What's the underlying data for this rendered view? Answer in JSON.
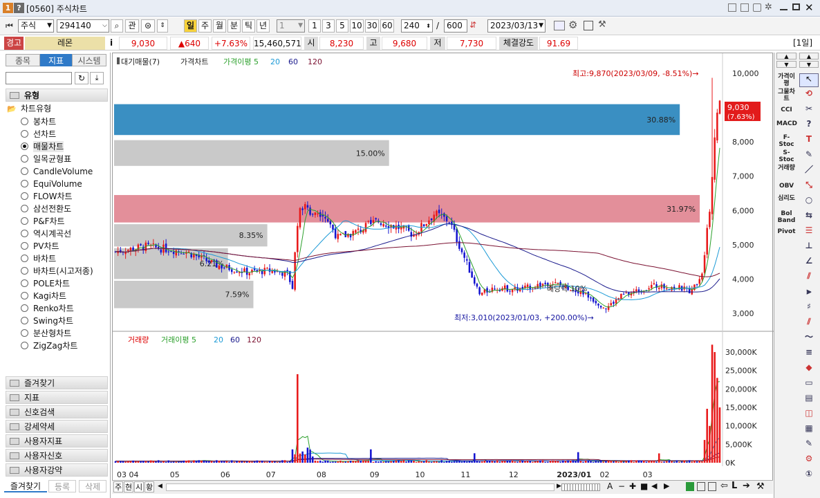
{
  "window": {
    "badge": "1",
    "help": "?",
    "title": "[0560] 주식차트"
  },
  "toolbar": {
    "market": "주식",
    "code": "294140",
    "btn_kwan": "관",
    "periods": [
      "일",
      "주",
      "월",
      "분",
      "틱",
      "년"
    ],
    "interval_value": "1",
    "quick": [
      "1",
      "3",
      "5",
      "10",
      "30",
      "60"
    ],
    "count": "240",
    "slash": "/",
    "total": "600",
    "date": "2023/03/13"
  },
  "quote": {
    "warn": "경고",
    "name": "레몬",
    "info": "i",
    "price": "9,030",
    "change": "▲640",
    "pct": "+7.63%",
    "volume": "15,460,571",
    "open_label": "시",
    "open": "8,230",
    "high_label": "고",
    "high": "9,680",
    "low_label": "저",
    "low": "7,730",
    "strength_label": "체결강도",
    "strength": "91.69",
    "day": "[1일]"
  },
  "left": {
    "tabs": [
      "종목",
      "지표",
      "시스템"
    ],
    "group": "유형",
    "subgroup": "차트유형",
    "chart_types": [
      "봉차트",
      "선차트",
      "매물차트",
      "일목균형표",
      "CandleVolume",
      "EquiVolume",
      "FLOW차트",
      "삼선전환도",
      "P&F차트",
      "역시계곡선",
      "PV차트",
      "바차트",
      "바차트(시고저종)",
      "POLE차트",
      "Kagi차트",
      "Renko차트",
      "Swing차트",
      "분산형차트",
      "ZigZag차트"
    ],
    "selected_index": 2,
    "categories": [
      "즐겨찾기",
      "지표",
      "신호검색",
      "강세약세",
      "사용자지표",
      "사용자신호",
      "사용자강약"
    ],
    "footer": [
      "즐겨찾기",
      "등록",
      "삭제"
    ]
  },
  "chart": {
    "legend": {
      "a": "대기매물(7)",
      "b": "가격차트",
      "c": "가격이평 5",
      "d": "20",
      "e": "60",
      "f": "120"
    },
    "hi_label": "최고:9,870(2023/03/09, -8.51%)→",
    "lo_label": "최저:3,010(2023/01/03, +200.00%)→",
    "price_tag": "9,030",
    "price_pct": "(7.63%)",
    "vp_labels": [
      "30.88%",
      "15.00%",
      "31.97%",
      "8.35%",
      "6.21%",
      "7.59%"
    ],
    "ma_label": "배당락 10%",
    "y_price": [
      "10,000",
      "9,000",
      "8,000",
      "7,000",
      "6,000",
      "5,000",
      "4,000",
      "3,000"
    ],
    "vol_legend": {
      "a": "거래량",
      "b": "거래이평 5",
      "c": "20",
      "d": "60",
      "e": "120"
    },
    "y_vol": [
      "30,000K",
      "25,000K",
      "20,000K",
      "15,000K",
      "10,000K",
      "5,000K",
      "0K"
    ],
    "x_labels": [
      "03 04",
      "05",
      "06",
      "07",
      "08",
      "09",
      "10",
      "11",
      "12",
      "2023/01",
      "02",
      "03"
    ]
  },
  "bottom": {
    "tabs": [
      "주",
      "현",
      "시",
      "황"
    ]
  },
  "right": {
    "items": [
      "가격이평",
      "그물차트",
      "CCI",
      "MACD",
      "F-Stoc",
      "S-Stoc",
      "거래량",
      "OBV",
      "심리도",
      "Bol Band",
      "Pivot"
    ]
  },
  "chart_data": {
    "type": "candlestick",
    "x_range": [
      "2022/03",
      "2023/03"
    ],
    "y_price_range": [
      3000,
      10000
    ],
    "y_volume_range_K": [
      0,
      30000
    ],
    "high": {
      "value": 9870,
      "date": "2023/03/09"
    },
    "low": {
      "value": 3010,
      "date": "2023/01/03"
    },
    "last": {
      "value": 9030,
      "pct": 7.63
    },
    "volume_profile": [
      {
        "level_approx": 8500,
        "pct": 30.88
      },
      {
        "level_approx": 7700,
        "pct": 15.0
      },
      {
        "level_approx": 6000,
        "pct": 31.97
      },
      {
        "level_approx": 5300,
        "pct": 8.35
      },
      {
        "level_approx": 4400,
        "pct": 6.21
      },
      {
        "level_approx": 3700,
        "pct": 7.59
      }
    ],
    "series": [
      {
        "name": "가격이평 5"
      },
      {
        "name": "20"
      },
      {
        "name": "60"
      },
      {
        "name": "120"
      }
    ]
  },
  "colors": {
    "up": "#e8191a",
    "down": "#1414d0",
    "ma5": "#2ca02c",
    "ma20": "#1c9ad6",
    "ma60": "#1a1a8c",
    "ma120": "#7a1030",
    "vp_top": "#3a8fc2",
    "vp_red": "#e38f9a",
    "vp_gray": "#c9c9c9"
  }
}
